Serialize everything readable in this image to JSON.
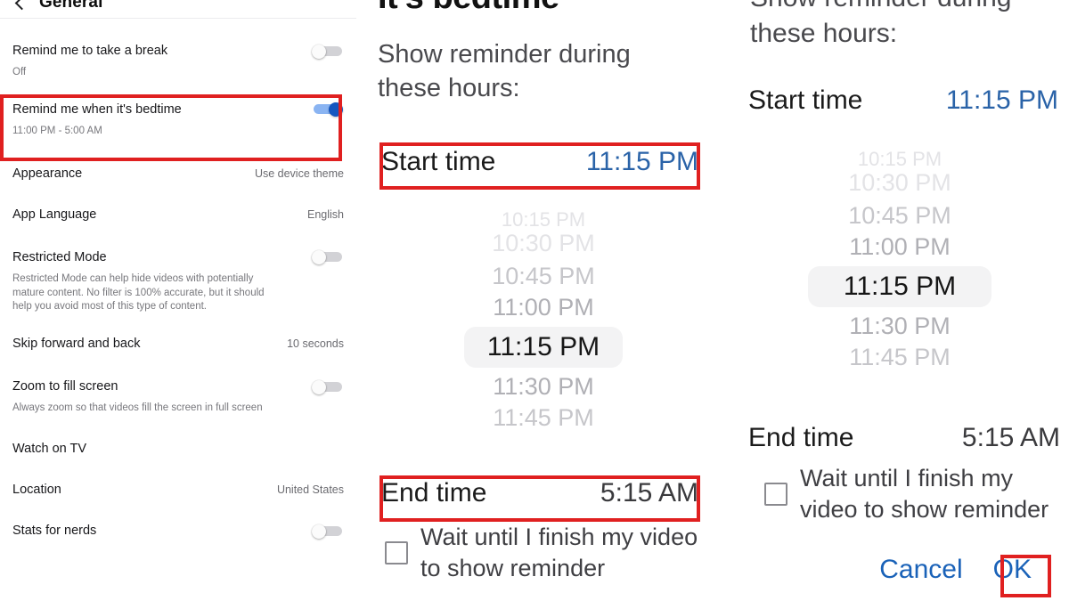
{
  "settings_panel": {
    "header": {
      "title": "General",
      "back_icon": "back-arrow-icon"
    },
    "rows": [
      {
        "label": "Remind me to take a break",
        "sub": "Off",
        "control": "toggle",
        "toggle_on": false
      },
      {
        "label": "Remind me when it's bedtime",
        "sub": "11:00 PM - 5:00 AM",
        "control": "toggle",
        "toggle_on": true
      },
      {
        "label": "Appearance",
        "value": "Use device theme",
        "control": "value"
      },
      {
        "label": "App Language",
        "value": "English",
        "control": "value"
      },
      {
        "label": "Restricted Mode",
        "sub": "Restricted Mode can help hide videos with potentially mature content. No filter is 100% accurate, but it should help you avoid most of this type of content.",
        "control": "toggle",
        "toggle_on": false
      },
      {
        "label": "Skip forward and back",
        "value": "10 seconds",
        "control": "value"
      },
      {
        "label": "Zoom to fill screen",
        "sub": "Always zoom so that videos fill the screen in full screen",
        "control": "toggle",
        "toggle_on": false
      },
      {
        "label": "Watch on TV",
        "value": "",
        "control": "none"
      },
      {
        "label": "Location",
        "value": "United States",
        "control": "value"
      },
      {
        "label": "Stats for nerds",
        "value": "",
        "control": "toggle",
        "toggle_on": false
      }
    ]
  },
  "mid_dialog": {
    "title": "It's bedtime",
    "subtitle": "Show reminder during these hours:",
    "start_label": "Start time",
    "start_value": "11:15 PM",
    "end_label": "End time",
    "end_value": "5:15 AM",
    "checkbox_label": "Wait until I finish my video to show reminder",
    "wheel": [
      {
        "text": "10:15 PM",
        "state": "faint"
      },
      {
        "text": "10:30 PM",
        "state": "faint"
      },
      {
        "text": "10:45 PM",
        "state": "dim"
      },
      {
        "text": "11:00 PM",
        "state": "near"
      },
      {
        "text": "11:15 PM",
        "state": "sel"
      },
      {
        "text": "11:30 PM",
        "state": "near"
      },
      {
        "text": "11:45 PM",
        "state": "dim"
      }
    ]
  },
  "right_dialog": {
    "subtitle": "Show reminder during these hours:",
    "start_label": "Start time",
    "start_value": "11:15 PM",
    "end_label": "End time",
    "end_value": "5:15 AM",
    "checkbox_label": "Wait until I finish my video to show reminder",
    "wheel": [
      {
        "text": "10:15 PM",
        "state": "faint"
      },
      {
        "text": "10:30 PM",
        "state": "faint"
      },
      {
        "text": "10:45 PM",
        "state": "dim"
      },
      {
        "text": "11:00 PM",
        "state": "near"
      },
      {
        "text": "11:15 PM",
        "state": "sel"
      },
      {
        "text": "11:30 PM",
        "state": "near"
      },
      {
        "text": "11:45 PM",
        "state": "dim"
      }
    ],
    "cancel_label": "Cancel",
    "ok_label": "OK"
  },
  "colors": {
    "annotation_red": "#e02020",
    "link_blue": "#1a62b8",
    "toggle_on_track": "#8ab4f2",
    "toggle_on_knob": "#1557c0",
    "toggle_off": "#d2d2d6"
  }
}
